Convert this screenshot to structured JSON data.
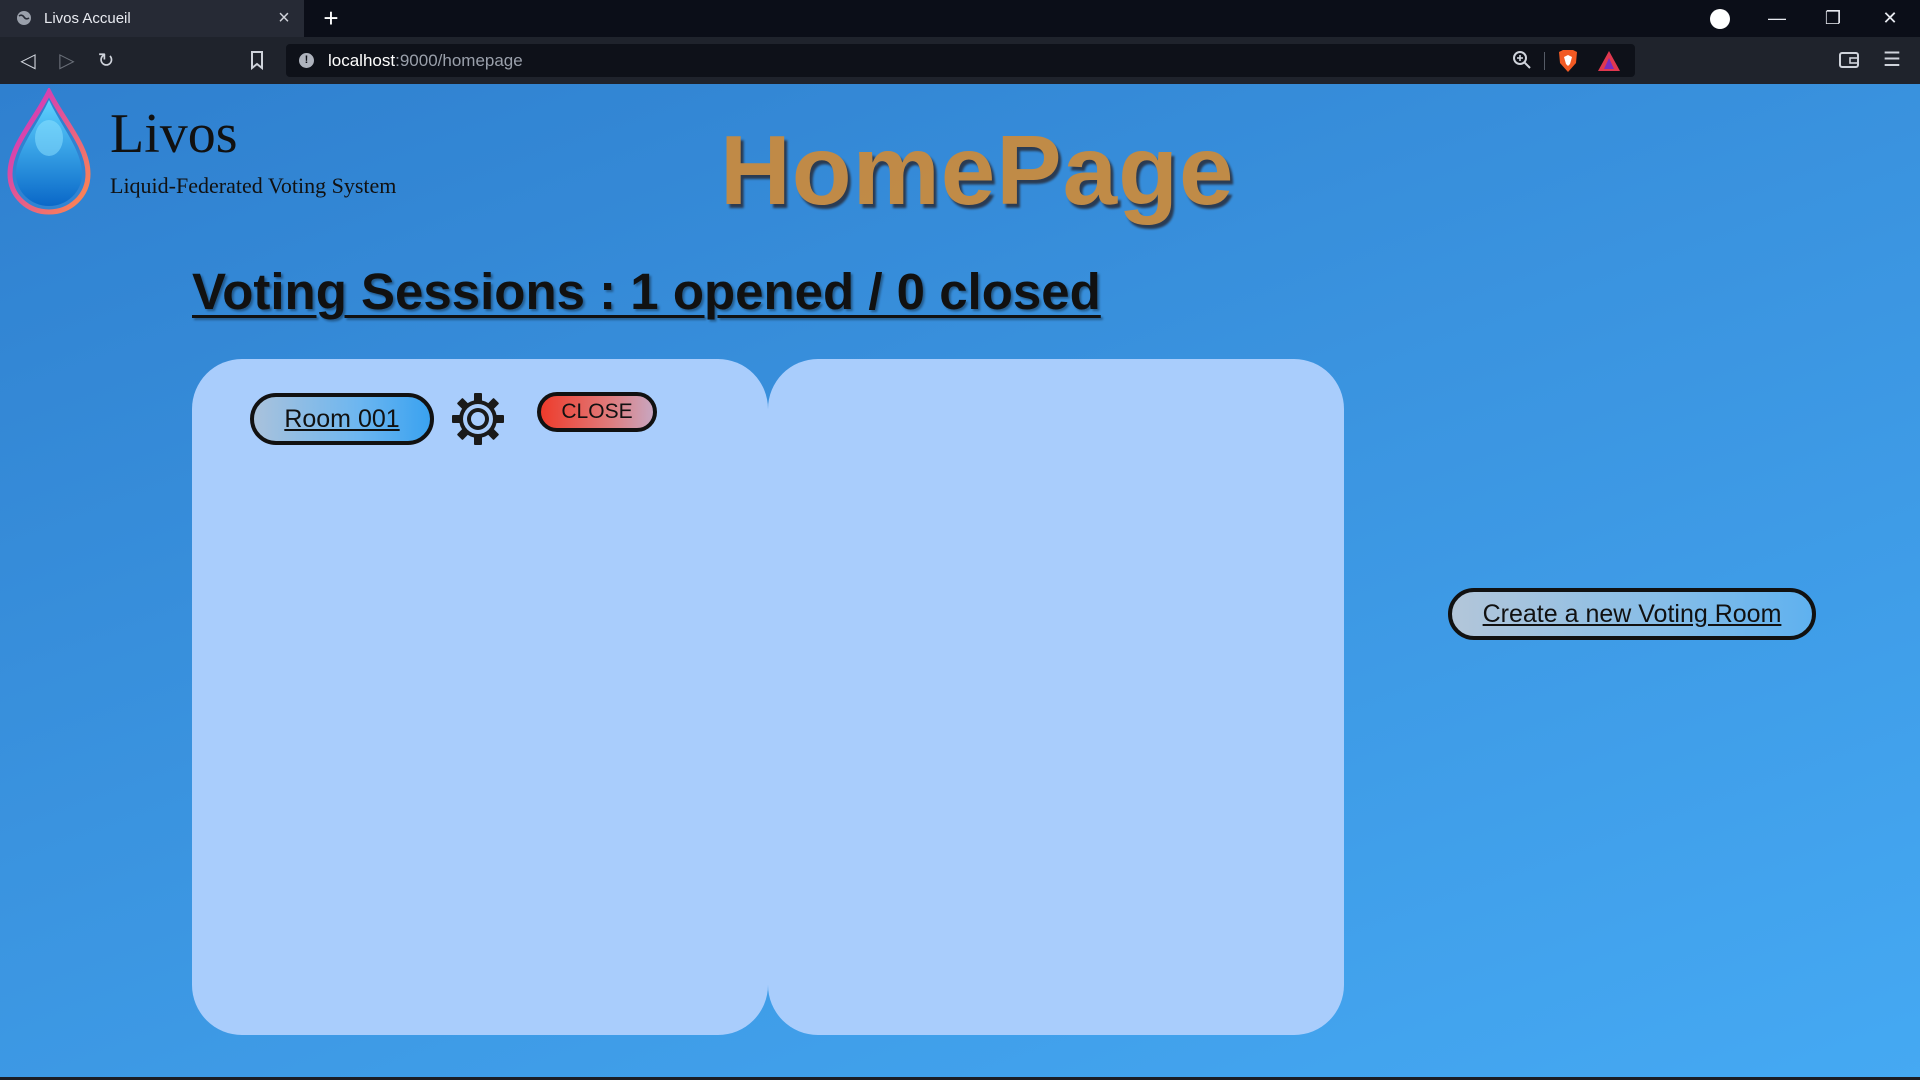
{
  "browser": {
    "tab_title": "Livos Accueil",
    "tab_close": "×",
    "new_tab": "+",
    "url_host": "localhost",
    "url_path": ":9000/homepage",
    "back": "◁",
    "forward": "▷",
    "reload": "↻",
    "minimize": "—",
    "restore": "❐",
    "close": "✕",
    "menu": "☰"
  },
  "header": {
    "logo_name": "Livos",
    "logo_tagline": "Liquid-Federated Voting System",
    "page_title": "HomePage"
  },
  "main": {
    "sessions_heading": "Voting Sessions : 1 opened / 0 closed",
    "open_rooms": [
      {
        "label": "Room 001",
        "close_label": "CLOSE"
      }
    ],
    "create_button": "Create a new Voting Room"
  },
  "colors": {
    "page_bg_start": "#2f80cf",
    "page_bg_end": "#45a9f3",
    "panel_bg": "#a9cdfc",
    "title_color": "#c88b40",
    "close_red": "#ee3b2b"
  },
  "icons": {
    "tab": "globe-icon",
    "settings": "gear-icon",
    "logo": "water-drop-icon"
  }
}
